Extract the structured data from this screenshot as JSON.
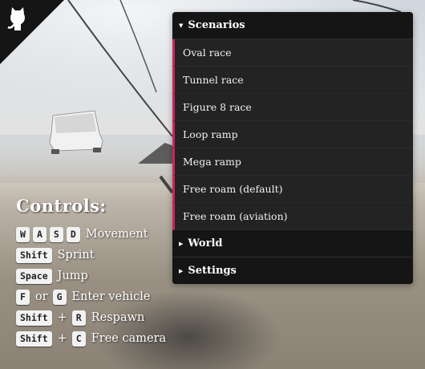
{
  "corner": {
    "icon": "github-octocat-icon"
  },
  "controls": {
    "title": "Controls:",
    "rows": [
      {
        "keys": [
          "W",
          "A",
          "S",
          "D"
        ],
        "joiner": "",
        "action": "Movement"
      },
      {
        "keys": [
          "Shift"
        ],
        "joiner": "",
        "action": "Sprint"
      },
      {
        "keys": [
          "Space"
        ],
        "joiner": "",
        "action": "Jump"
      },
      {
        "keys": [
          "F",
          "G"
        ],
        "joiner": "or",
        "action": "Enter vehicle"
      },
      {
        "keys": [
          "Shift",
          "R"
        ],
        "joiner": "+",
        "action": "Respawn"
      },
      {
        "keys": [
          "Shift",
          "C"
        ],
        "joiner": "+",
        "action": "Free camera"
      }
    ]
  },
  "menu": {
    "scenarios": {
      "label": "Scenarios",
      "expanded": true,
      "items": [
        "Oval race",
        "Tunnel race",
        "Figure 8 race",
        "Loop ramp",
        "Mega ramp",
        "Free roam (default)",
        "Free roam (aviation)"
      ]
    },
    "world": {
      "label": "World",
      "expanded": false
    },
    "settings": {
      "label": "Settings",
      "expanded": false
    }
  },
  "colors": {
    "accent": "#d0235a",
    "menu_bg": "#1d1d1d",
    "key_bg": "#f2f2f2"
  }
}
